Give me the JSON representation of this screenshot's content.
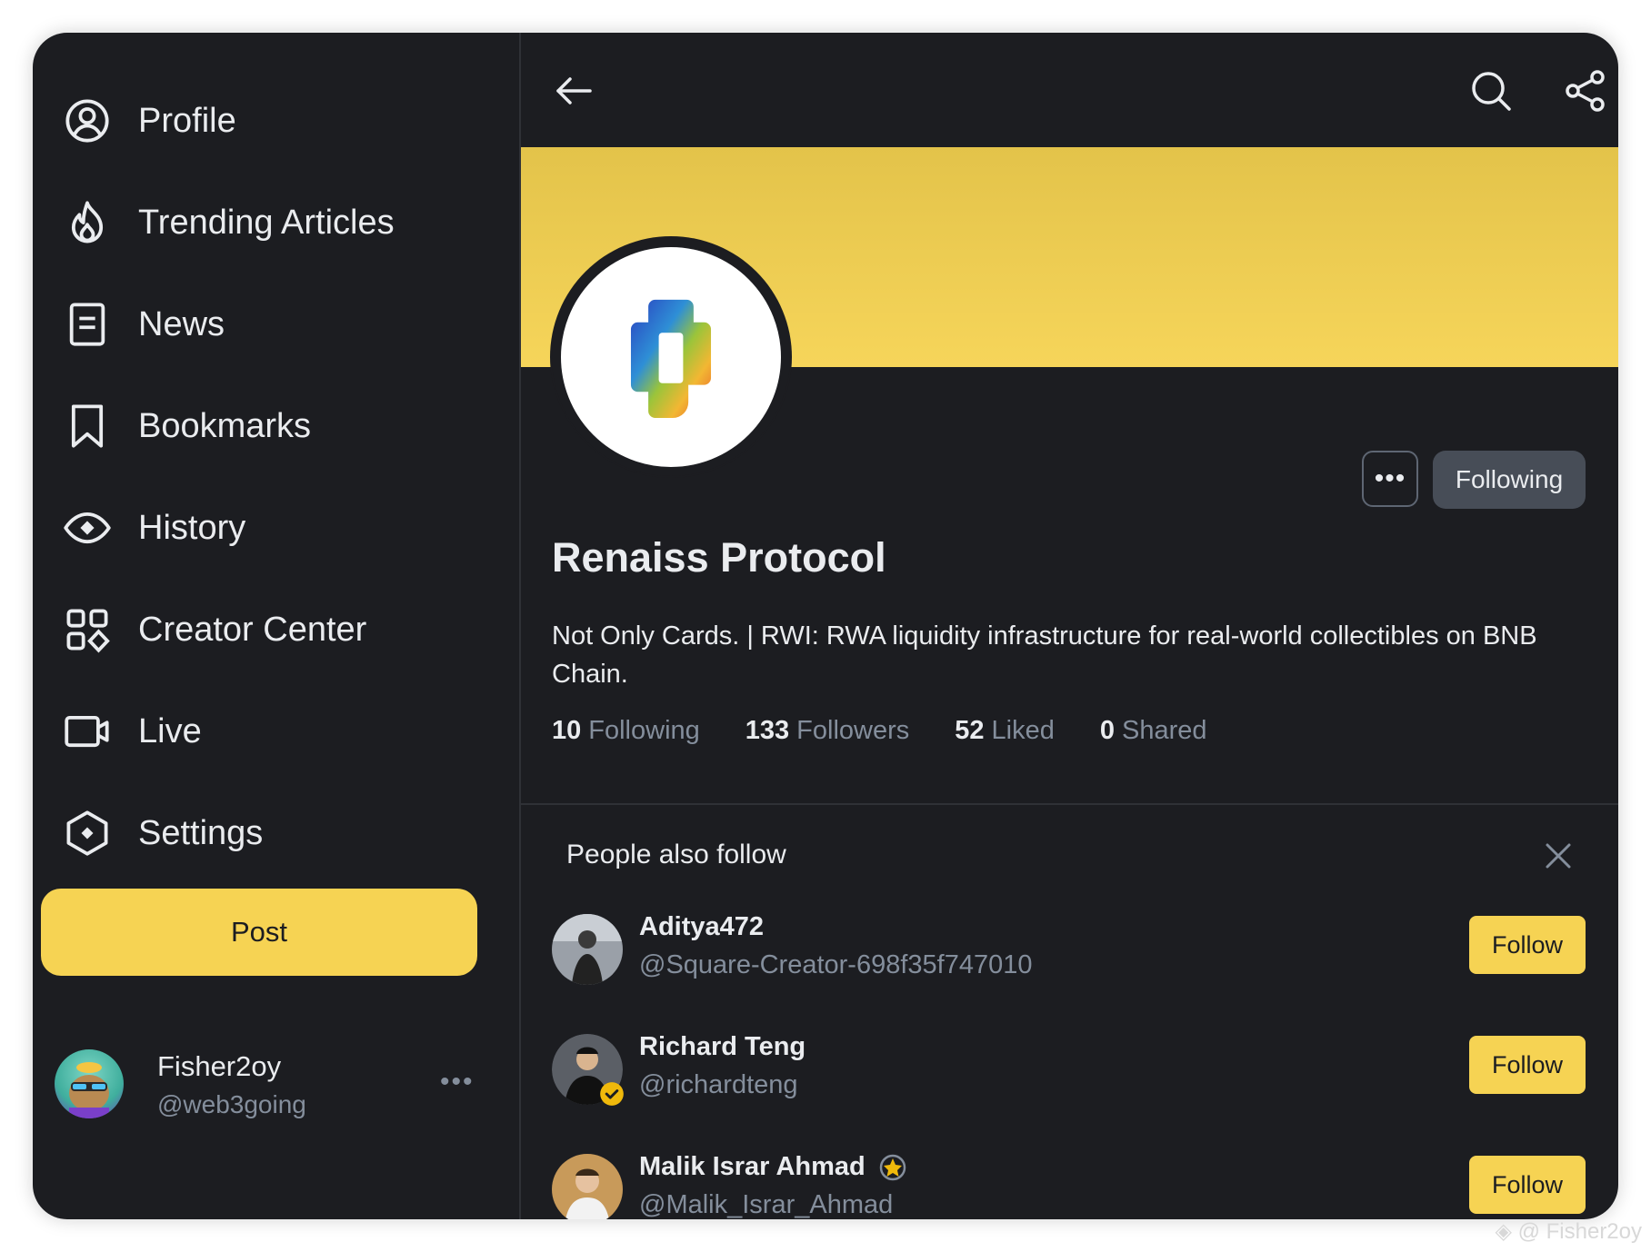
{
  "sidebar": {
    "items": [
      {
        "label": "Profile",
        "icon": "profile-icon"
      },
      {
        "label": "Trending Articles",
        "icon": "flame-icon"
      },
      {
        "label": "News",
        "icon": "news-icon"
      },
      {
        "label": "Bookmarks",
        "icon": "bookmark-icon"
      },
      {
        "label": "History",
        "icon": "eye-icon"
      },
      {
        "label": "Creator Center",
        "icon": "grid-icon"
      },
      {
        "label": "Live",
        "icon": "video-icon"
      },
      {
        "label": "Settings",
        "icon": "settings-icon"
      }
    ],
    "post_label": "Post",
    "user": {
      "name": "Fisher2oy",
      "handle": "@web3going",
      "more": "•••"
    }
  },
  "profile": {
    "name": "Renaiss Protocol",
    "bio": "Not Only Cards.  | RWI: RWA liquidity infrastructure for real-world collectibles on BNB Chain.",
    "more_label": "•••",
    "following_button": "Following",
    "stats": [
      {
        "value": "10",
        "label": "Following"
      },
      {
        "value": "133",
        "label": "Followers"
      },
      {
        "value": "52",
        "label": "Liked"
      },
      {
        "value": "0",
        "label": "Shared"
      }
    ]
  },
  "people_also_follow": {
    "title": "People also follow",
    "items": [
      {
        "name": "Aditya472",
        "handle": "@Square-Creator-698f35f747010",
        "button": "Follow"
      },
      {
        "name": "Richard Teng",
        "handle": "@richardteng",
        "button": "Follow"
      },
      {
        "name": "Malik Israr Ahmad",
        "handle": "@Malik_Israr_Ahmad",
        "button": "Follow"
      }
    ]
  },
  "watermark": "@ Fisher2oy",
  "colors": {
    "accent": "#f6d353",
    "background": "#1c1d21",
    "muted": "#848e9c",
    "text": "#eaecef"
  }
}
